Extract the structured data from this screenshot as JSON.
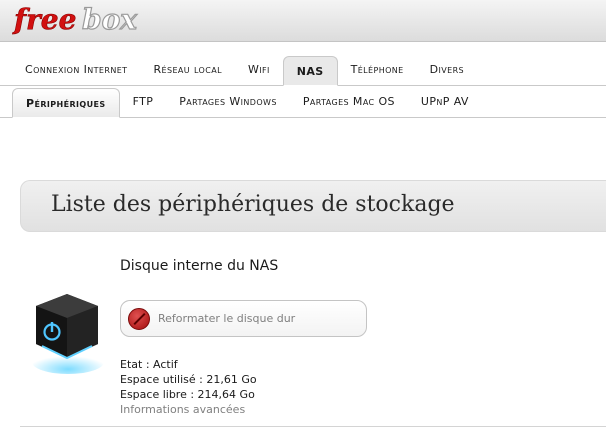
{
  "brand": {
    "logo_text": "freebox"
  },
  "primary_tabs": [
    {
      "label": "Connexion Internet",
      "active": false
    },
    {
      "label": "Réseau local",
      "active": false
    },
    {
      "label": "Wifi",
      "active": false
    },
    {
      "label": "NAS",
      "active": true
    },
    {
      "label": "Téléphone",
      "active": false
    },
    {
      "label": "Divers",
      "active": false
    }
  ],
  "secondary_tabs": [
    {
      "label": "Périphériques",
      "active": true
    },
    {
      "label": "FTP",
      "active": false
    },
    {
      "label": "Partages Windows",
      "active": false
    },
    {
      "label": "Partages Mac OS",
      "active": false
    },
    {
      "label": "UPnP AV",
      "active": false
    }
  ],
  "section": {
    "title": "Liste des périphériques de stockage"
  },
  "device": {
    "name": "Disque interne du NAS",
    "icon": "power-cube-icon",
    "reformat_button": {
      "label": "Reformater le disque dur",
      "icon": "forbidden-icon"
    },
    "status": "Etat : Actif",
    "used_space": "Espace utilisé : 21,61 Go",
    "free_space": "Espace libre : 214,64 Go",
    "advanced_link": "Informations avancées"
  },
  "colors": {
    "logo_red": "#d21010",
    "link_gray": "#808080",
    "header_bg": "#e8e8e8"
  }
}
